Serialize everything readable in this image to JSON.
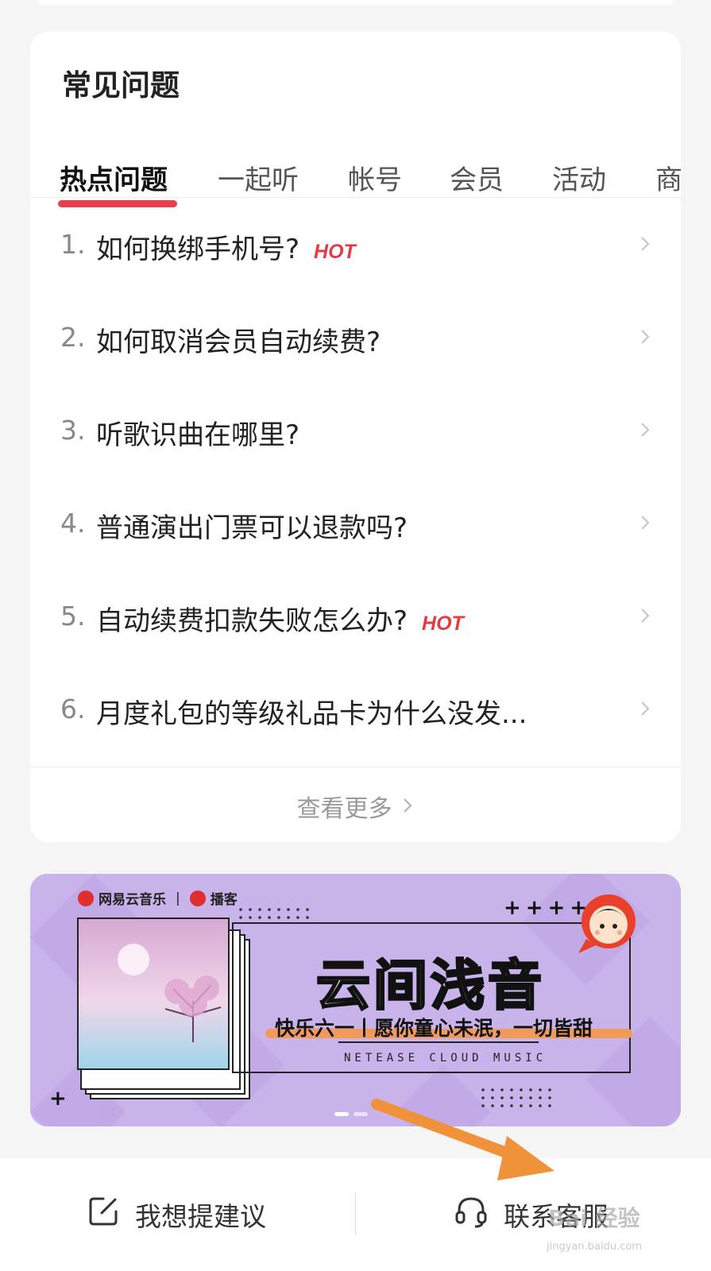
{
  "faq": {
    "title": "常见问题",
    "tabs": [
      "热点问题",
      "一起听",
      "帐号",
      "会员",
      "活动",
      "商"
    ],
    "active_tab": 0,
    "items": [
      {
        "num": "1.",
        "text": "如何换绑手机号?",
        "hot": "HOT"
      },
      {
        "num": "2.",
        "text": "如何取消会员自动续费?",
        "hot": ""
      },
      {
        "num": "3.",
        "text": "听歌识曲在哪里?",
        "hot": ""
      },
      {
        "num": "4.",
        "text": "普通演出门票可以退款吗?",
        "hot": ""
      },
      {
        "num": "5.",
        "text": "自动续费扣款失败怎么办?",
        "hot": "HOT"
      },
      {
        "num": "6.",
        "text": "月度礼包的等级礼品卡为什么没发...",
        "hot": ""
      }
    ],
    "see_more": "查看更多"
  },
  "banner": {
    "brand": "网易云音乐",
    "brand2": "播客",
    "title": "云间浅音",
    "subtitle": "快乐六一丨愿你童心未泯，一切皆甜",
    "english": "NETEASE CLOUD MUSIC",
    "plus_marks": "++++",
    "plus_single": "+",
    "slides": 2,
    "active_slide": 0
  },
  "bottom_bar": {
    "suggest": "我想提建议",
    "contact": "联系客服"
  },
  "watermark": {
    "text": "Bai 经验",
    "url": "jingyan.baidu.com"
  },
  "colors": {
    "accent": "#e8404a",
    "hot": "#e23b43",
    "banner_bg": "#c8b3ea",
    "arrow": "#f0923a"
  }
}
